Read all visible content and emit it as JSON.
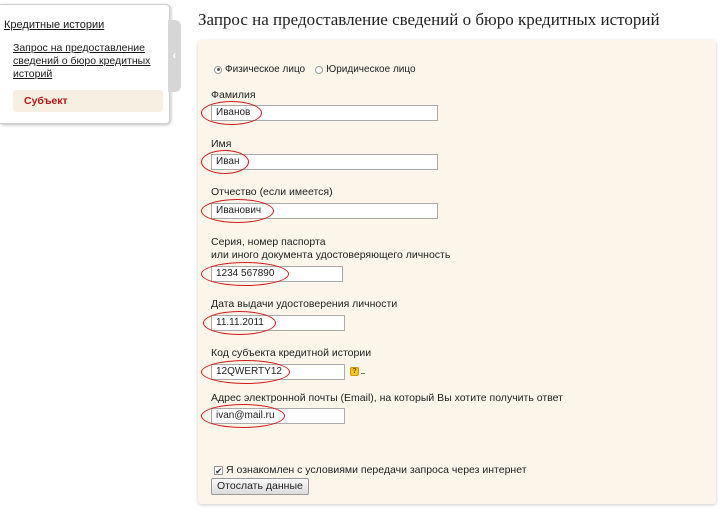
{
  "sidebar": {
    "title": "Кредитные истории",
    "link": "Запрос на предоставление сведений о бюро кредитных историй",
    "active": "Субъект",
    "collapse_icon": "chevron-left-icon",
    "collapse_glyph": "‹"
  },
  "page": {
    "title": "Запрос на предоставление сведений о бюро кредитных историй"
  },
  "form": {
    "person_type": {
      "options": [
        "Физическое лицо",
        "Юридическое лицо"
      ],
      "selected": "Физическое лицо"
    },
    "surname": {
      "label": "Фамилия",
      "value": "Иванов"
    },
    "name": {
      "label": "Имя",
      "value": "Иван"
    },
    "patronymic": {
      "label": "Отчество (если имеется)",
      "value": "Иванович"
    },
    "passport": {
      "label_line1": "Серия, номер паспорта",
      "label_line2": "или иного документа удостоверяющего личность",
      "value": "1234 567890"
    },
    "issue_date": {
      "label": "Дата выдачи удостоверения личности",
      "value": "11.11.2011"
    },
    "subject_code": {
      "label": "Код субъекта кредитной истории",
      "value": "12QWERTY12",
      "help_glyph": "?"
    },
    "email": {
      "label": "Адрес электронной почты (Email), на который Вы хотите получить ответ",
      "value": "ivan@mail.ru"
    },
    "agree": {
      "label": "Я ознакомлен с условиями передачи запроса через интернет",
      "checked": true,
      "check_glyph": "✔"
    },
    "submit_label": "Отослать данные"
  },
  "colors": {
    "panel_bg": "#fcf6ea",
    "highlight_oval": "#d21a1a",
    "active_text": "#b01818"
  }
}
